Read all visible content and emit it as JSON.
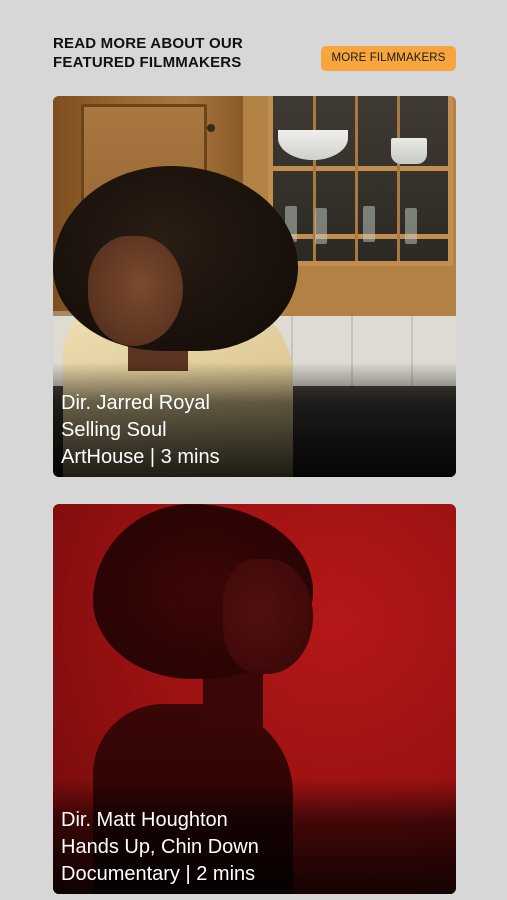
{
  "section": {
    "title_line_1": "READ MORE ABOUT OUR",
    "title_line_2": "FEATURED FILMMAKERS",
    "more_button_label": "MORE FILMMAKERS",
    "more_button_color": "#f7a53c"
  },
  "films": [
    {
      "director": "Dir. Jarred Royal",
      "title": "Selling Soul",
      "meta": "ArtHouse | 3 mins"
    },
    {
      "director": "Dir. Matt Houghton",
      "title": "Hands Up, Chin Down",
      "meta": "Documentary | 2 mins"
    }
  ]
}
